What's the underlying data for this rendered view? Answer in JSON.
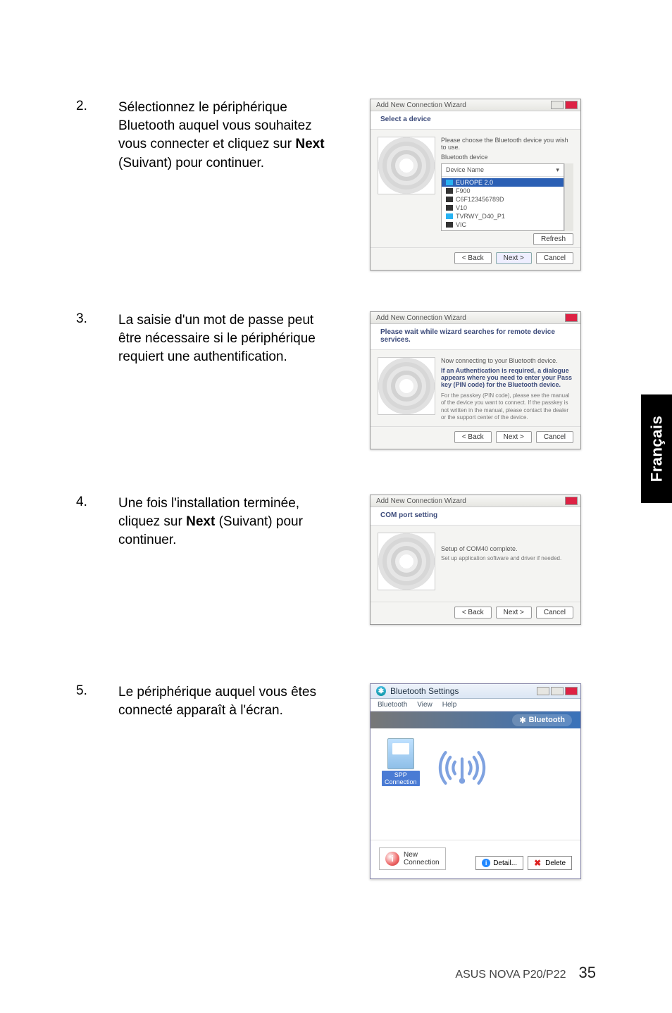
{
  "language_tab": "Français",
  "footer": {
    "product": "ASUS NOVA P20/P22",
    "page": "35"
  },
  "steps": [
    {
      "num": "2.",
      "text_parts": [
        "Sélectionnez le périphérique Bluetooth auquel vous souhaitez vous connecter et cliquez sur ",
        "Next",
        " (Suivant) pour continuer."
      ]
    },
    {
      "num": "3.",
      "text_parts": [
        "La saisie d'un mot de passe peut être nécessaire si le périphérique requiert une authentification."
      ]
    },
    {
      "num": "4.",
      "text_parts": [
        "Une fois l'installation terminée, cliquez sur ",
        "Next",
        " (Suivant) pour continuer."
      ]
    },
    {
      "num": "5.",
      "text_parts": [
        "Le périphérique auquel vous êtes connecté apparaît à l'écran."
      ]
    }
  ],
  "dialog2": {
    "title": "Add New Connection Wizard",
    "heading": "Select a device",
    "instruction": "Please choose the Bluetooth device you wish to use.",
    "group_label": "Bluetooth device",
    "field_label": "Device Name",
    "items": [
      "EUROPE 2.0",
      "F900",
      "C6F123456789D",
      "V10",
      "TVRWY_D40_P1",
      "VIC"
    ],
    "refresh": "Refresh",
    "back": "< Back",
    "next": "Next >",
    "cancel": "Cancel"
  },
  "dialog3": {
    "title": "Add New Connection Wizard",
    "heading": "Please wait while wizard searches for remote device services.",
    "line1": "Now connecting to your Bluetooth device.",
    "bold": "If an Authentication is required, a dialogue appears where you need to enter your Pass key (PIN code) for the Bluetooth device.",
    "line2": "For the passkey (PIN code), please see the manual of the device you want to connect. If the passkey is not written in the manual, please contact the dealer or the support center of the device.",
    "back": "< Back",
    "next": "Next >",
    "cancel": "Cancel"
  },
  "dialog4": {
    "title": "Add New Connection Wizard",
    "heading": "COM port setting",
    "line1": "Setup of COM40 complete.",
    "line2": "Set up application software and driver if needed.",
    "back": "< Back",
    "next": "Next >",
    "cancel": "Cancel"
  },
  "btwin": {
    "title": "Bluetooth Settings",
    "menus": [
      "Bluetooth",
      "View",
      "Help"
    ],
    "brand": "Bluetooth",
    "device_label": "SPP\nConnection",
    "newconn_top": "New",
    "newconn_bottom": "Connection",
    "detail": "Detail...",
    "delete": "Delete"
  }
}
